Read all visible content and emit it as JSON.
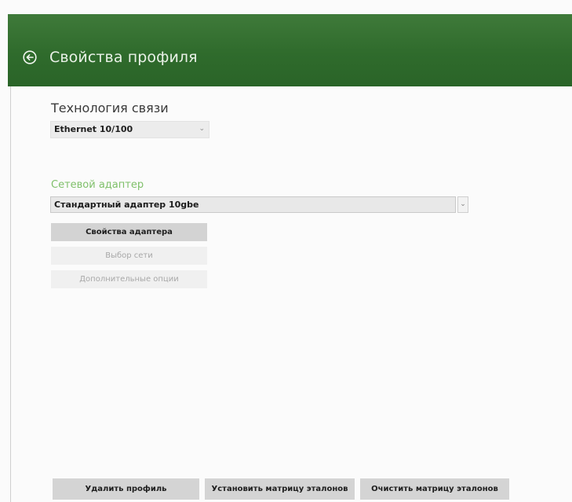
{
  "header": {
    "title": "Свойства профиля",
    "back_icon": "back-arrow-circle-icon",
    "background_color": "#2f6b2c"
  },
  "technology": {
    "label": "Технология связи",
    "selected": "Ethernet 10/100"
  },
  "adapter": {
    "label": "Сетевой адаптер",
    "label_color": "#7fc06a",
    "selected": "Стандартный адаптер 10gbe"
  },
  "buttons": {
    "adapter_properties": "Свойства адаптера",
    "network_select": "Выбор сети",
    "extra_options": "Дополнительные опции",
    "delete_profile": "Удалить профиль",
    "set_reference_matrix": "Установить матрицу эталонов",
    "clear_reference_matrix": "Очистить матрицу эталонов"
  }
}
